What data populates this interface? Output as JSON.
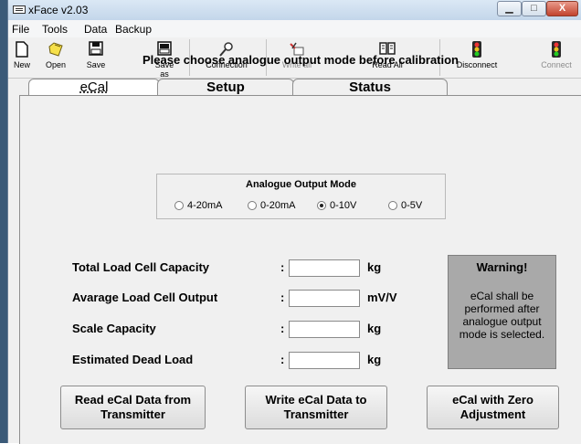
{
  "window": {
    "title": "xFace  v2.03",
    "controls": {
      "minimize": "▁",
      "maximize": "□",
      "close": "X"
    }
  },
  "menu": {
    "items": [
      "File",
      "Tools",
      "Data",
      "Backup"
    ]
  },
  "toolbar": {
    "buttons": [
      {
        "label": "New",
        "icon": "new-file-icon",
        "enabled": true
      },
      {
        "label": "Open",
        "icon": "open-folder-icon",
        "enabled": true
      },
      {
        "label": "Save",
        "icon": "floppy-disk-icon",
        "enabled": true
      },
      {
        "label": "Save as",
        "icon": "save-as-icon",
        "enabled": true
      },
      {
        "label": "Connection",
        "icon": "connection-icon",
        "enabled": true
      },
      {
        "label": "Write all",
        "icon": "write-all-icon",
        "enabled": false
      },
      {
        "label": "Read All",
        "icon": "read-all-book-icon",
        "enabled": true
      },
      {
        "label": "Disconnect",
        "icon": "traffic-light-icon",
        "enabled": true
      },
      {
        "label": "Connect",
        "icon": "traffic-light-icon",
        "enabled": false
      }
    ]
  },
  "tabs": [
    {
      "label": "eCal",
      "active": true
    },
    {
      "label": "Setup",
      "active": false
    },
    {
      "label": "Status",
      "active": false
    }
  ],
  "ecal": {
    "instruction": "Please choose analogue output mode before calibration",
    "output_mode": {
      "title": "Analogue Output Mode",
      "options": [
        "4-20mA",
        "0-20mA",
        "0-10V",
        "0-5V"
      ],
      "selected": "0-10V"
    },
    "fields": [
      {
        "label": "Total Load Cell Capacity",
        "colon": ":",
        "value": "",
        "unit": "kg"
      },
      {
        "label": "Avarage Load Cell Output",
        "colon": ":",
        "value": "",
        "unit": "mV/V"
      },
      {
        "label": "Scale Capacity",
        "colon": ":",
        "value": "",
        "unit": "kg"
      },
      {
        "label": "Estimated Dead Load",
        "colon": ":",
        "value": "",
        "unit": "kg"
      }
    ],
    "warning": {
      "title": "Warning!",
      "text": "eCal shall be performed after analogue output mode is selected."
    },
    "buttons": {
      "read": "Read eCal Data from Transmitter",
      "write": "Write eCal Data to Transmitter",
      "zero": "eCal with Zero Adjustment"
    }
  },
  "colors": {
    "warning_bg": "#a9a9a9",
    "titlebar": "#c3d6ea",
    "close_button": "#c2442f"
  }
}
